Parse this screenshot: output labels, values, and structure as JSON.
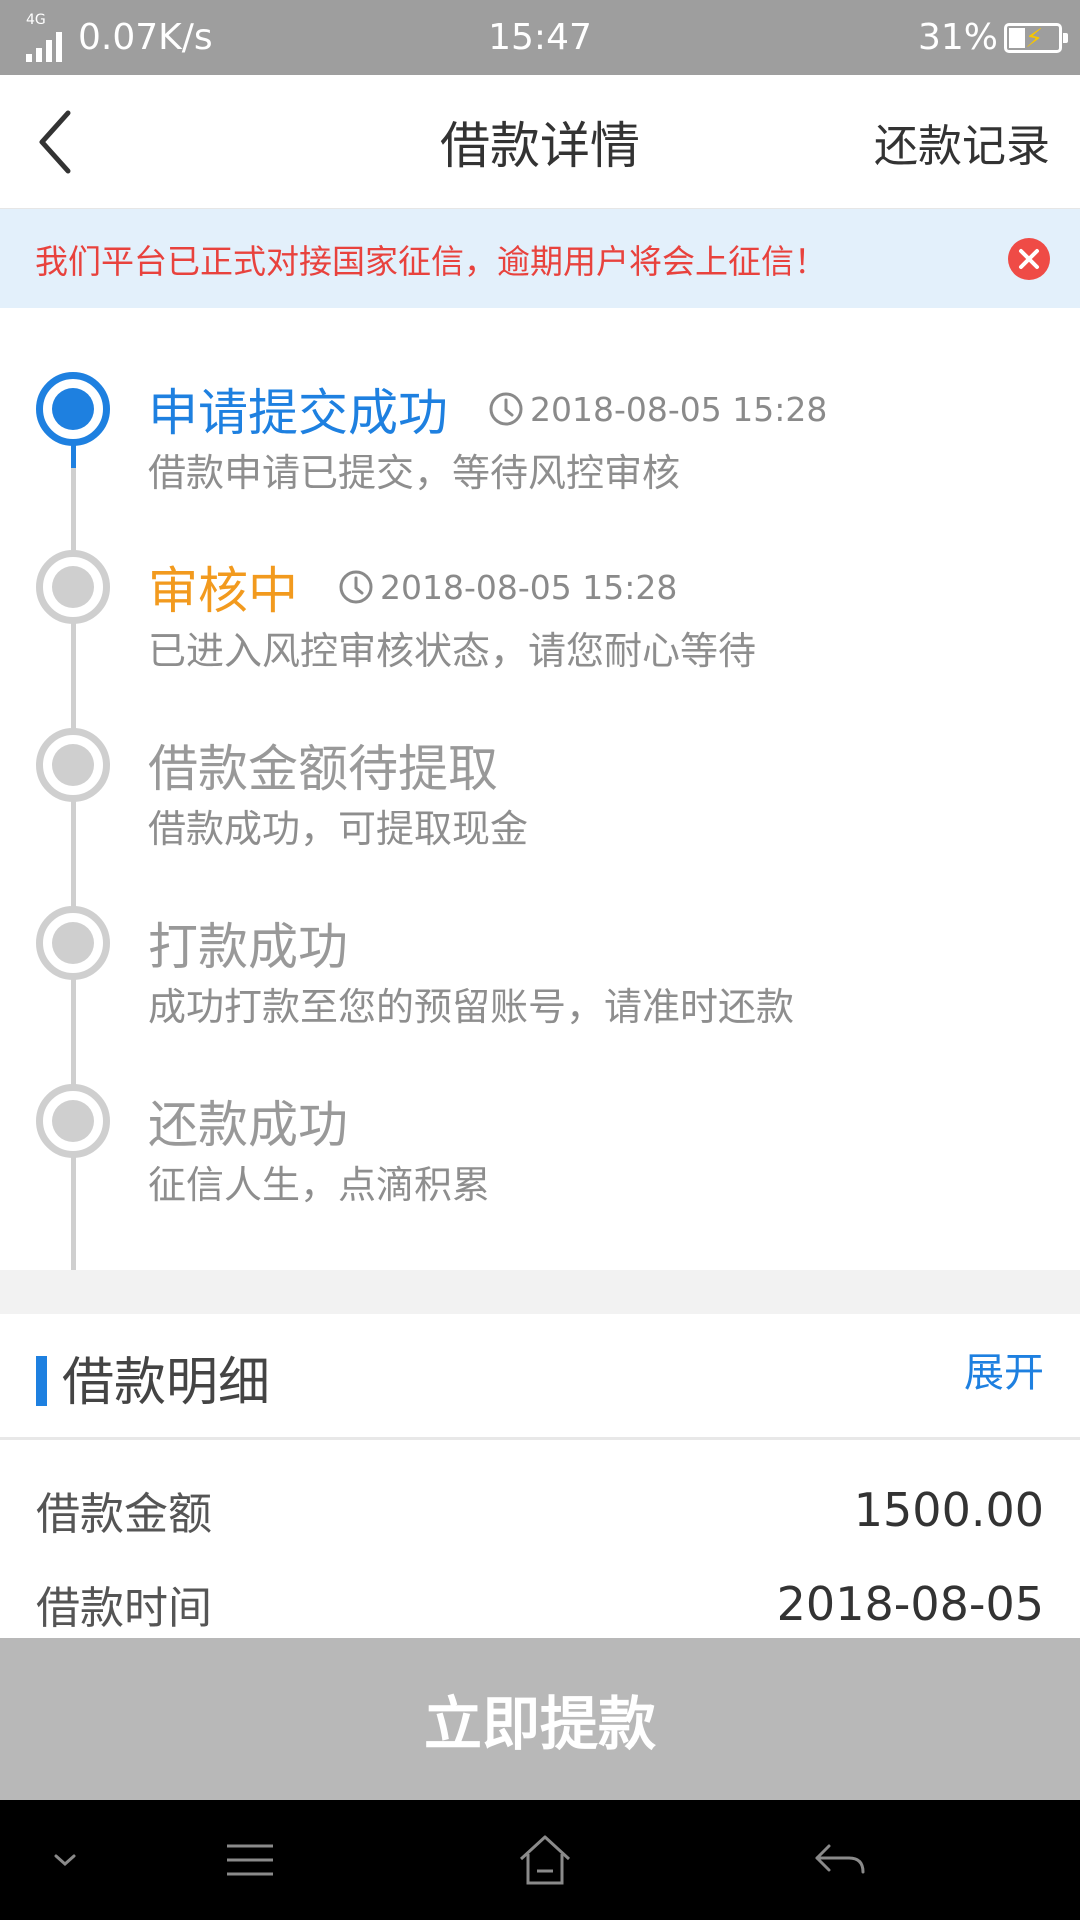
{
  "status_bar": {
    "network_type": "4G",
    "speed": "0.07K/s",
    "time": "15:47",
    "battery": "31%"
  },
  "header": {
    "back_icon": "chevron-left-icon",
    "title": "借款详情",
    "records_label": "还款记录"
  },
  "notice": {
    "text": "我们平台已正式对接国家征信，逾期用户将会上征信！",
    "close_icon": "close-circle-icon",
    "color": "#e8423d"
  },
  "timeline": {
    "steps": [
      {
        "title": "申请提交成功",
        "time": "2018-08-05 15:28",
        "desc": "借款申请已提交，等待风控审核",
        "state": "done"
      },
      {
        "title": "审核中",
        "time": "2018-08-05 15:28",
        "desc": "已进入风控审核状态，请您耐心等待",
        "state": "current"
      },
      {
        "title": "借款金额待提取",
        "desc": "借款成功，可提取现金",
        "state": "pending"
      },
      {
        "title": "打款成功",
        "desc": "成功打款至您的预留账号，请准时还款",
        "state": "pending"
      },
      {
        "title": "还款成功",
        "desc": "征信人生，点滴积累",
        "state": "pending"
      }
    ]
  },
  "details": {
    "title": "借款明细",
    "expand_label": "展开",
    "rows": [
      {
        "label": "借款金额",
        "value": "1500.00"
      },
      {
        "label": "借款时间",
        "value": "2018-08-05"
      }
    ]
  },
  "action": {
    "label": "立即提款"
  },
  "colors": {
    "accent_blue": "#1e80e0",
    "status_orange": "#f29a1e",
    "inactive_gray": "#cfcfcf"
  }
}
